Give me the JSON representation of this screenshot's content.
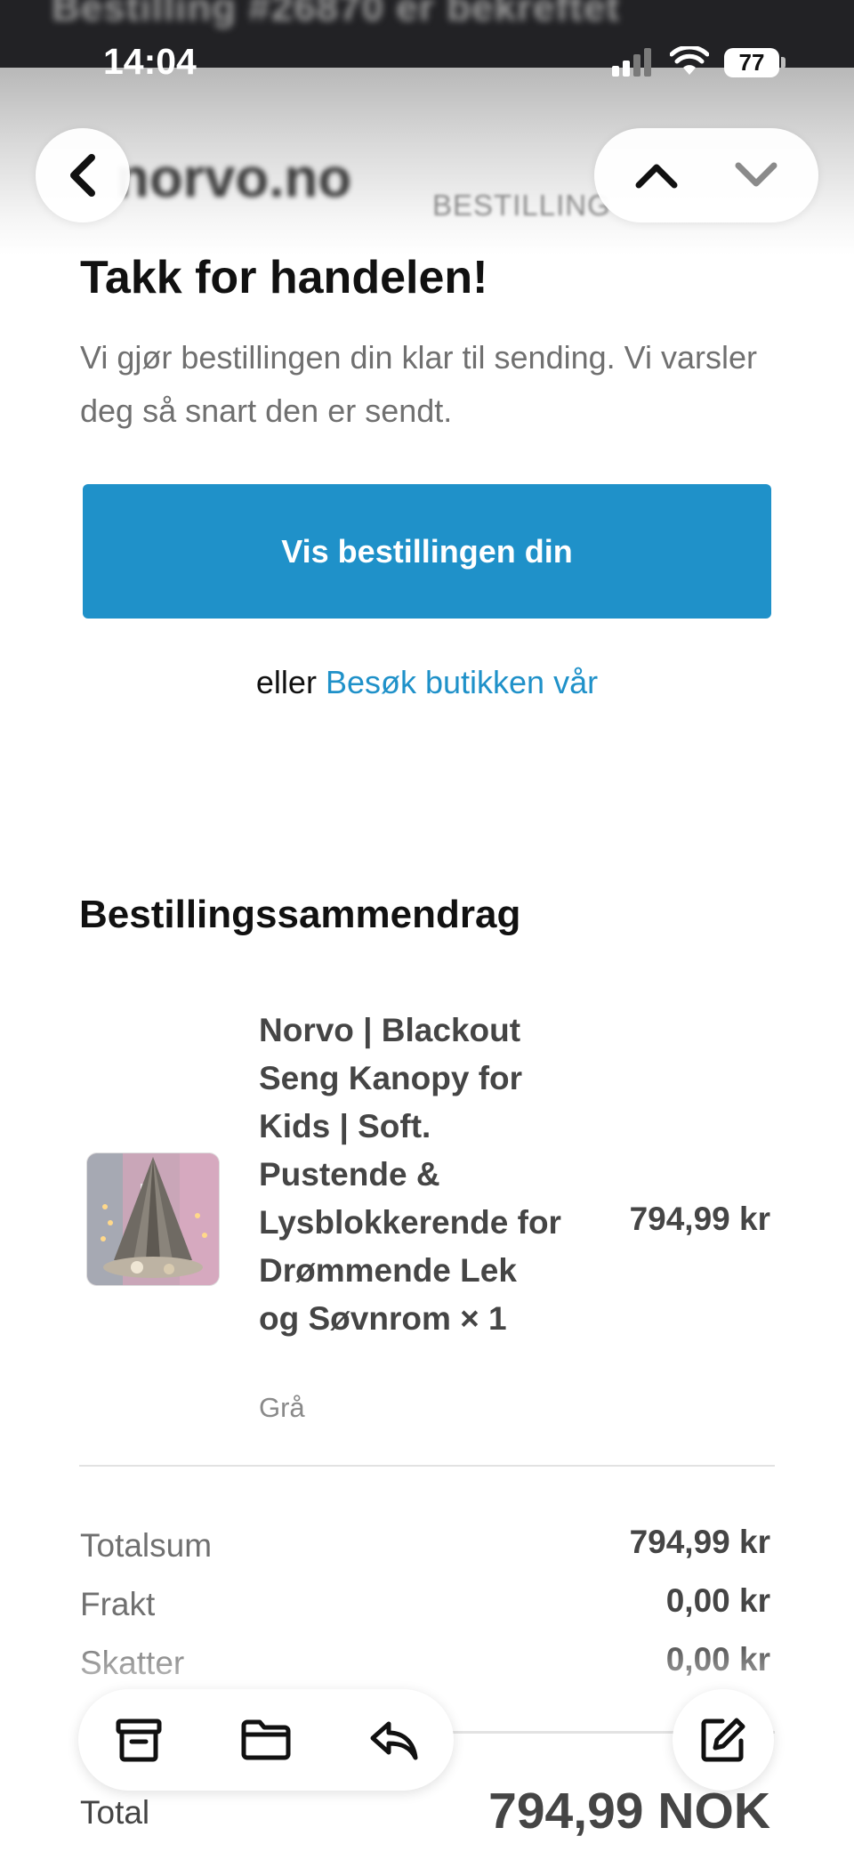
{
  "status_bar": {
    "time": "14:04",
    "battery": "77"
  },
  "header": {
    "blurred_subject": "Bestilling #26870 er bekreftet",
    "blurred_logo": "norvo.no",
    "blurred_order_label": "BESTILLING"
  },
  "nav": {
    "back_icon": "chevron-left-icon",
    "prev_icon": "chevron-up-icon",
    "next_icon": "chevron-down-icon"
  },
  "email": {
    "title": "Takk for handelen!",
    "intro": "Vi gjør bestillingen din klar til sending. Vi varsler deg så snart den er sendt.",
    "cta_label": "Vis bestillingen din",
    "or_text": "eller",
    "visit_store_link": "Besøk butikken vår",
    "summary_title": "Bestillingssammendrag",
    "item": {
      "name": "Norvo | Blackout Seng Kanopy for Kids | Soft. Pustende & Lysblokkerende for Drømmende Lek og Søvnrom × 1",
      "variant": "Grå",
      "price": "794,99 kr"
    },
    "totals": [
      {
        "label": "Totalsum",
        "value": "794,99 kr"
      },
      {
        "label": "Frakt",
        "value": "0,00 kr"
      },
      {
        "label": "Skatter",
        "value": "0,00 kr"
      }
    ],
    "total_label": "Total",
    "total_value": "794,99 NOK"
  },
  "toolbar": {
    "icons": [
      "archive-icon",
      "folder-icon",
      "reply-icon",
      "compose-icon"
    ]
  },
  "colors": {
    "accent": "#1f91c9",
    "muted_text": "#707070"
  }
}
